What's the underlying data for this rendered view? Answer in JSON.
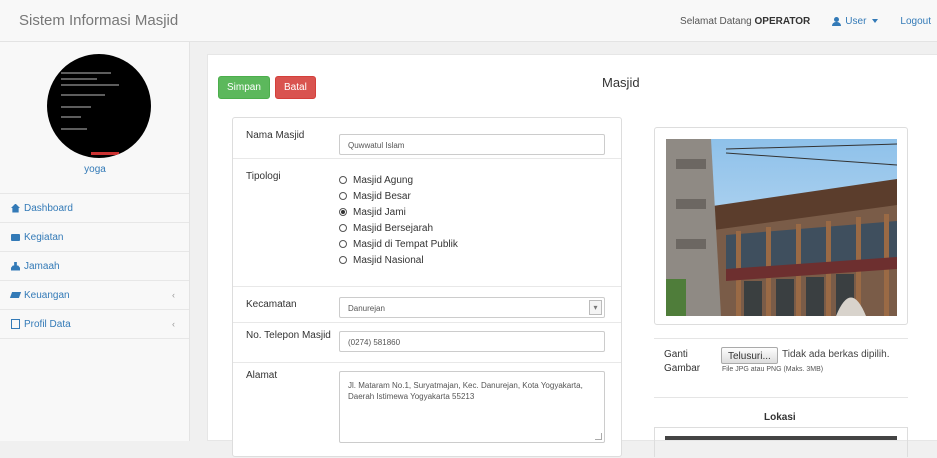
{
  "header": {
    "brand": "Sistem Informasi Masjid",
    "welcome_prefix": "Selamat Datang",
    "welcome_role": "OPERATOR",
    "user_label": "User",
    "logout_label": "Logout"
  },
  "sidebar": {
    "username": "yoga",
    "items": [
      {
        "label": "Dashboard",
        "icon": "home-icon"
      },
      {
        "label": "Kegiatan",
        "icon": "calendar-icon"
      },
      {
        "label": "Jamaah",
        "icon": "users-icon"
      },
      {
        "label": "Keuangan",
        "icon": "money-icon",
        "chevron": "‹"
      },
      {
        "label": "Profil Data",
        "icon": "document-icon",
        "chevron": "‹"
      }
    ]
  },
  "toolbar": {
    "save_label": "Simpan",
    "cancel_label": "Batal",
    "page_title": "Masjid"
  },
  "form": {
    "nama_label": "Nama Masjid",
    "nama_value": "Quwwatul Islam",
    "tipologi_label": "Tipologi",
    "tipologi_options": [
      "Masjid Agung",
      "Masjid Besar",
      "Masjid Jami",
      "Masjid Bersejarah",
      "Masjid di Tempat Publik",
      "Masjid Nasional"
    ],
    "tipologi_selected": "Masjid Jami",
    "kecamatan_label": "Kecamatan",
    "kecamatan_value": "Danurejan",
    "telepon_label": "No. Telepon Masjid",
    "telepon_value": "(0274) 581860",
    "alamat_label": "Alamat",
    "alamat_value": "Jl. Mataram No.1, Suryatmajan, Kec. Danurejan, Kota Yogyakarta, Daerah Istimewa Yogyakarta 55213"
  },
  "image_section": {
    "ganti_label": "Ganti Gambar",
    "browse_label": "Telusuri...",
    "no_file_text": "Tidak ada berkas dipilih.",
    "hint": "File JPG atau PNG (Maks. 3MB)",
    "lokasi_title": "Lokasi"
  },
  "colors": {
    "accent": "#337ab7",
    "save": "#5cb85c",
    "cancel": "#d9534f"
  }
}
